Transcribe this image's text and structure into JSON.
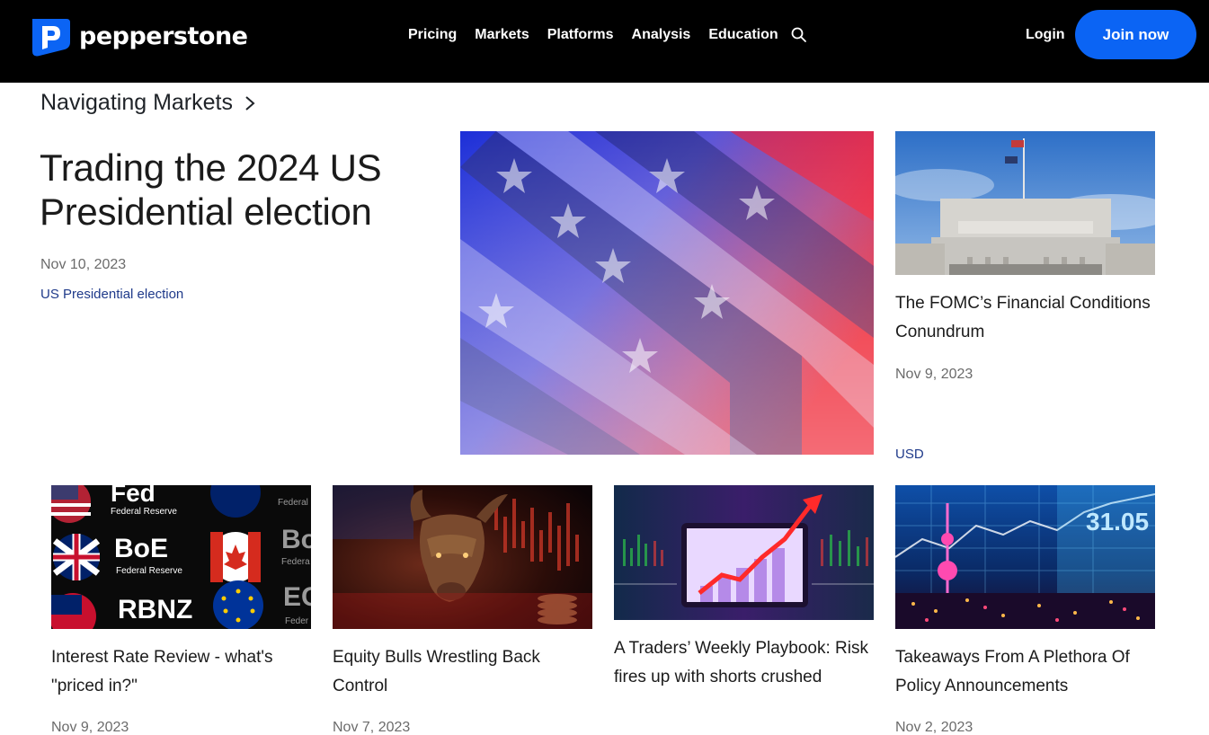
{
  "brand": {
    "name": "pepperstone",
    "accent": "#0b64f4"
  },
  "nav": {
    "items": [
      {
        "label": "Pricing"
      },
      {
        "label": "Markets"
      },
      {
        "label": "Platforms"
      },
      {
        "label": "Analysis"
      },
      {
        "label": "Education"
      }
    ],
    "search_icon": "search-icon",
    "login_label": "Login",
    "join_label": "Join now"
  },
  "section": {
    "title": "Navigating Markets",
    "icon": "chevron-right-icon"
  },
  "featured": {
    "title": "Trading the 2024 US Presidential election",
    "date": "Nov 10, 2023",
    "tag": "US Presidential election"
  },
  "side_article": {
    "title": "The FOMC’s Financial Conditions Conundrum",
    "date": "Nov 9, 2023",
    "tag": "USD"
  },
  "articles": [
    {
      "title": "Interest Rate Review - what's \"priced in?\"",
      "date": "Nov 9, 2023",
      "image_text": {
        "t1": "Fed",
        "s1": "Federal Reserve",
        "t2": "BoE",
        "s2": "Federal Reserve",
        "t3": "RBNZ",
        "r1": "Federal",
        "r2": "Bo",
        "r3": "Federa",
        "r4": "EC",
        "r5": "Feder"
      }
    },
    {
      "title": "Equity Bulls Wrestling Back Control",
      "date": "Nov 7, 2023"
    },
    {
      "title": "A Traders’ Weekly Playbook: Risk fires up with shorts crushed",
      "date": ""
    },
    {
      "title": "Takeaways From A Plethora Of Policy Announcements",
      "date": "Nov 2, 2023",
      "image_text": {
        "ticker": "31.05"
      }
    }
  ]
}
